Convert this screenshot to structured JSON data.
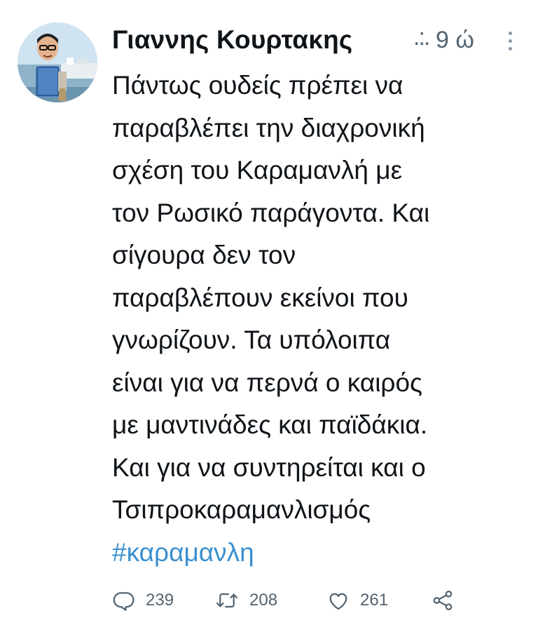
{
  "tweet": {
    "display_name": "Γιαννης Κουρτακης",
    "truncation": ".:.",
    "timestamp": "9 ώ",
    "text_lines": [
      "Πάντως ουδείς πρέπει να",
      "παραβλέπει την διαχρονική",
      "σχέση του Καραμανλή με",
      "τον Ρωσικό παράγοντα. Και",
      "σίγουρα δεν τον",
      "παραβλέπουν εκείνοι που",
      "γνωρίζουν. Τα υπόλοιπα",
      "είναι για να περνά ο καιρός",
      "με μαντινάδες και παϊδάκια.",
      "Και για να συντηρείται και ο",
      "Τσιπροκαραμανλισμός"
    ],
    "hashtag": "#καραμανλη",
    "hashtag_color": "#3a8fd0"
  },
  "actions": {
    "replies": "239",
    "retweets": "208",
    "likes": "261"
  },
  "icons": {
    "more": "more-vertical-icon",
    "reply": "reply-icon",
    "retweet": "retweet-icon",
    "like": "heart-icon",
    "share": "share-icon"
  },
  "colors": {
    "text": "#0f1419",
    "secondary": "#536471",
    "link": "#3a8fd0"
  }
}
